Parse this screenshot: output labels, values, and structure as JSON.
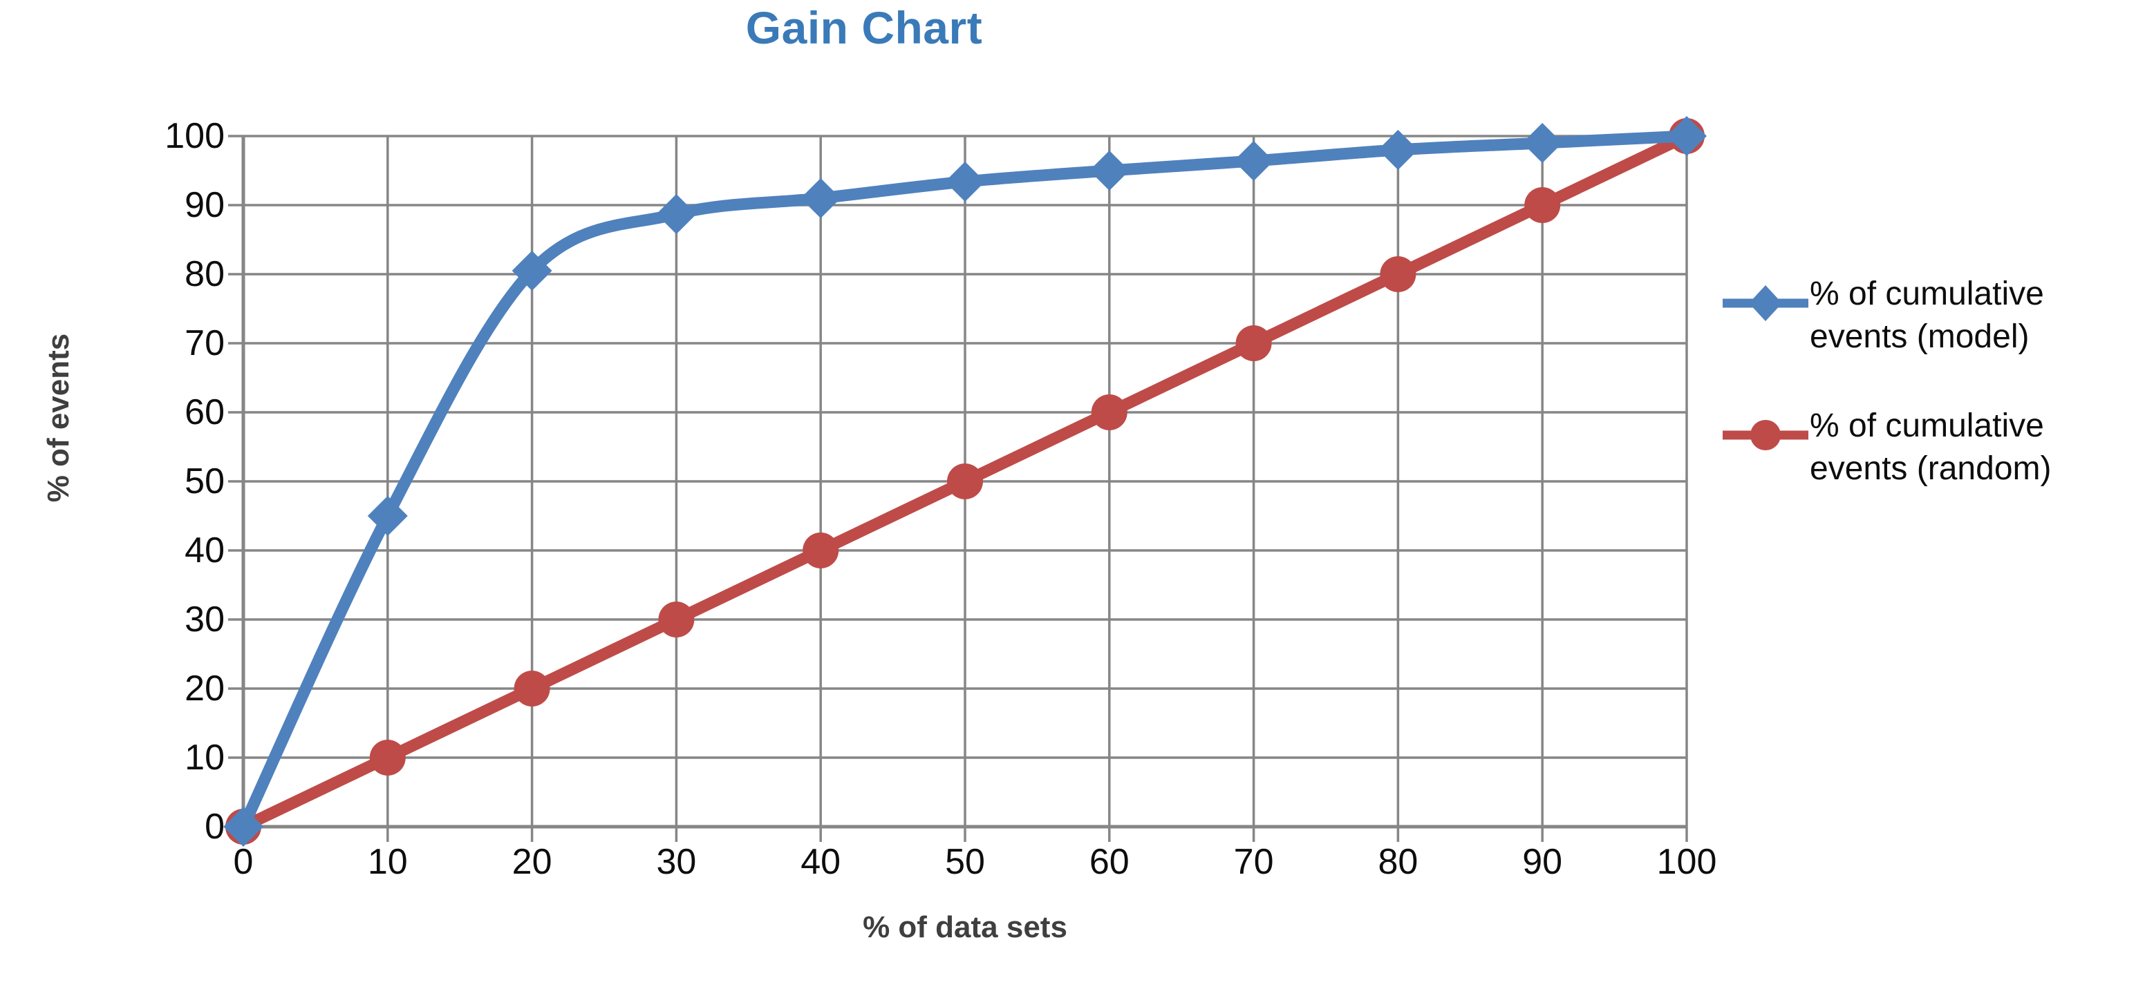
{
  "chart_data": {
    "type": "line",
    "title": "Gain Chart",
    "xlabel": "% of data sets",
    "ylabel": "% of events",
    "xlim": [
      0,
      100
    ],
    "ylim": [
      0,
      100
    ],
    "xticks": [
      "0",
      "10",
      "20",
      "30",
      "40",
      "50",
      "60",
      "70",
      "80",
      "90",
      "100"
    ],
    "yticks": [
      "0",
      "10",
      "20",
      "30",
      "40",
      "50",
      "60",
      "70",
      "80",
      "90",
      "100"
    ],
    "x": [
      0,
      10,
      20,
      30,
      40,
      50,
      60,
      70,
      80,
      90,
      100
    ],
    "grid": true,
    "legend_position": "right",
    "series": [
      {
        "name": "% of cumulative events (model)",
        "values": [
          0,
          45,
          80.5,
          88.7,
          91,
          93.4,
          95,
          96.4,
          98,
          99,
          100
        ],
        "color": "#4F81BD",
        "marker": "diamond",
        "smooth": true
      },
      {
        "name": "% of cumulative events (random)",
        "values": [
          0,
          10,
          20,
          30,
          40,
          50,
          60,
          70,
          80,
          90,
          100
        ],
        "color": "#BE4B48",
        "marker": "circle",
        "smooth": false
      }
    ]
  },
  "colors": {
    "title": "#3A7AB8",
    "axis_title": "#3F3F3F",
    "tick_label": "#0D0D0D",
    "grid": "#868686",
    "axis_line": "#868686",
    "series_model": "#4F81BD",
    "series_random": "#BE4B48",
    "background": "#FFFFFF"
  },
  "legend": {
    "items": [
      {
        "label": "% of cumulative events (model)",
        "marker": "diamond-marker-icon",
        "color": "#4F81BD"
      },
      {
        "label": "% of cumulative events (random)",
        "marker": "circle-marker-icon",
        "color": "#BE4B48"
      }
    ]
  }
}
